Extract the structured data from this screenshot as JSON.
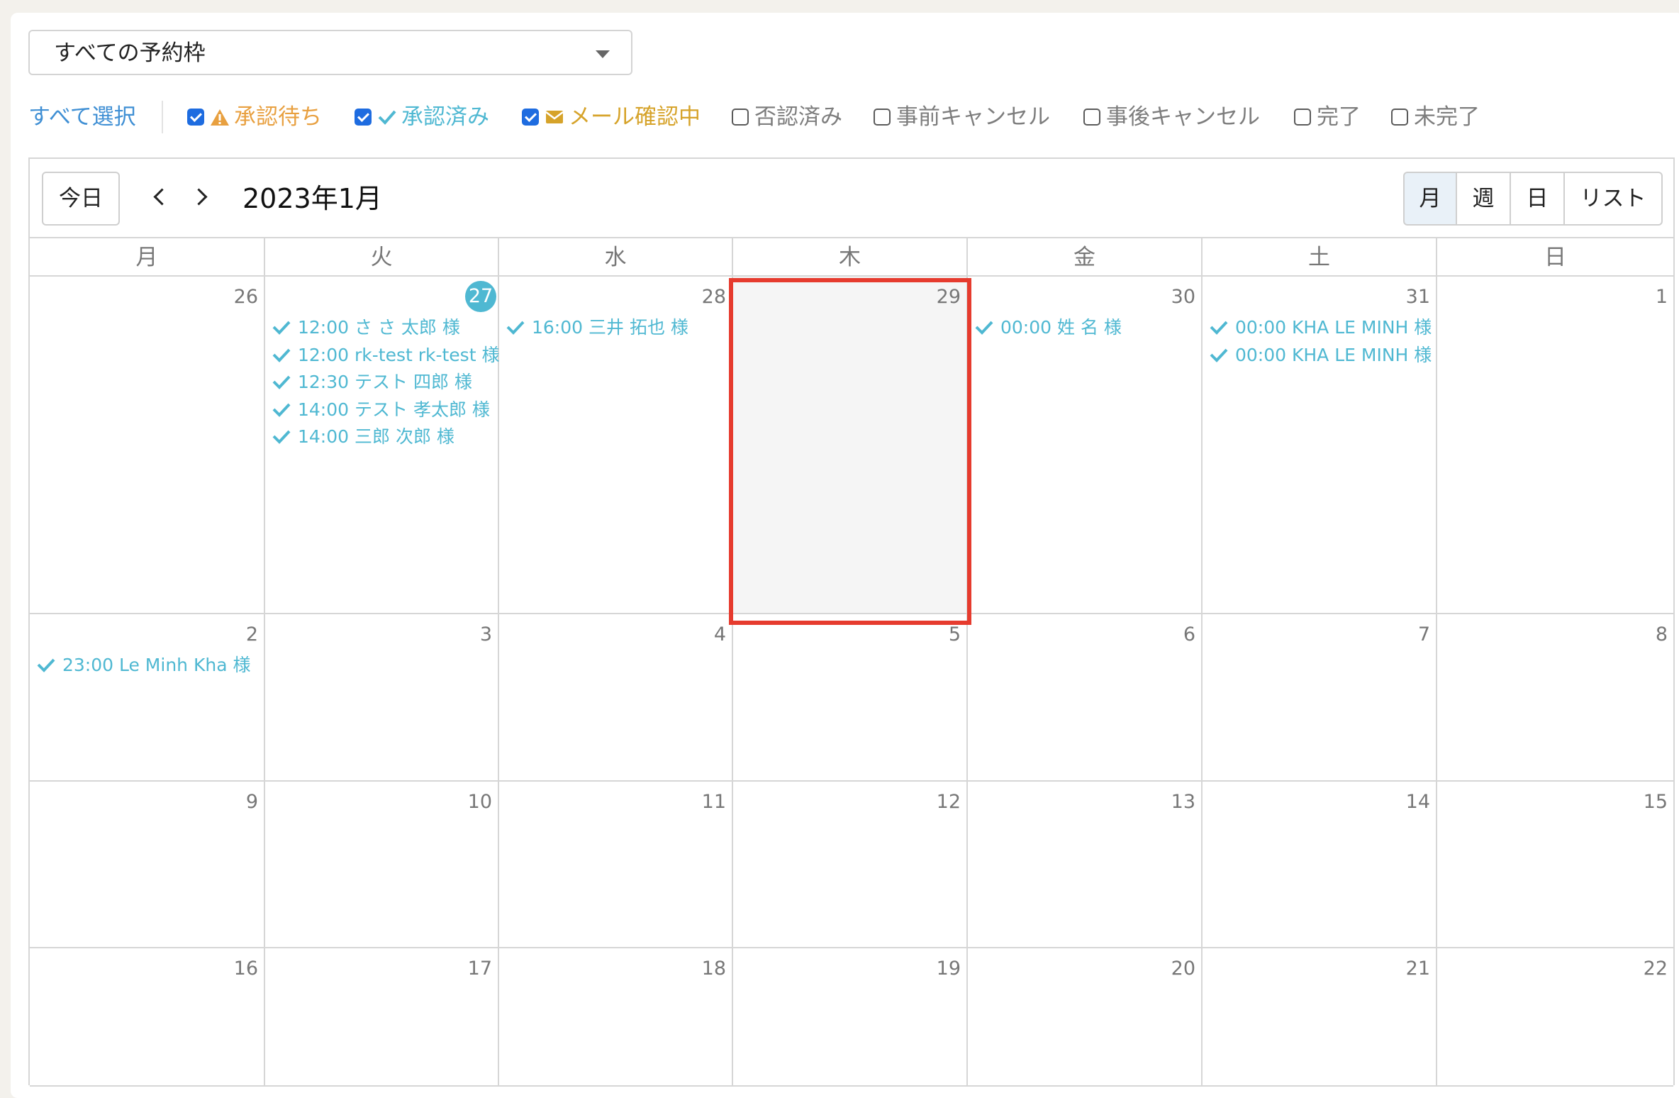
{
  "slot_select": {
    "label": "すべての予約枠"
  },
  "filters": {
    "select_all": "すべて選択",
    "items": [
      {
        "label": "承認待ち",
        "checked": true,
        "icon": "warning-icon",
        "color": "#e8a040"
      },
      {
        "label": "承認済み",
        "checked": true,
        "icon": "check-icon",
        "color": "#4fb8d2"
      },
      {
        "label": "メール確認中",
        "checked": true,
        "icon": "mail-icon",
        "color": "#d6a32a"
      },
      {
        "label": "否認済み",
        "checked": false
      },
      {
        "label": "事前キャンセル",
        "checked": false
      },
      {
        "label": "事後キャンセル",
        "checked": false
      },
      {
        "label": "完了",
        "checked": false
      },
      {
        "label": "未完了",
        "checked": false
      }
    ]
  },
  "toolbar": {
    "today": "今日",
    "title": "2023年1月",
    "views": [
      "月",
      "週",
      "日",
      "リスト"
    ],
    "active_view": "月"
  },
  "weekdays": [
    "月",
    "火",
    "水",
    "木",
    "金",
    "土",
    "日"
  ],
  "weeks": [
    [
      {
        "day": "26",
        "events": []
      },
      {
        "day": "27",
        "today": true,
        "events": [
          "12:00 さ さ 太郎 様",
          "12:00 rk-test rk-test 様",
          "12:30 テスト 四郎 様",
          "14:00 テスト 孝太郎 様",
          "14:00 三郎 次郎 様"
        ]
      },
      {
        "day": "28",
        "events": [
          "16:00 三井 拓也 様"
        ]
      },
      {
        "day": "29",
        "highlighted": true,
        "events": []
      },
      {
        "day": "30",
        "events": [
          "00:00 姓 名 様"
        ]
      },
      {
        "day": "31",
        "events": [
          "00:00 KHA LE MINH 様",
          "00:00 KHA LE MINH 様"
        ]
      },
      {
        "day": "1",
        "events": []
      }
    ],
    [
      {
        "day": "2",
        "events": [
          "23:00 Le Minh Kha 様"
        ]
      },
      {
        "day": "3",
        "events": []
      },
      {
        "day": "4",
        "events": []
      },
      {
        "day": "5",
        "events": []
      },
      {
        "day": "6",
        "events": []
      },
      {
        "day": "7",
        "events": []
      },
      {
        "day": "8",
        "events": []
      }
    ],
    [
      {
        "day": "9",
        "events": []
      },
      {
        "day": "10",
        "events": []
      },
      {
        "day": "11",
        "events": []
      },
      {
        "day": "12",
        "events": []
      },
      {
        "day": "13",
        "events": []
      },
      {
        "day": "14",
        "events": []
      },
      {
        "day": "15",
        "events": []
      }
    ],
    [
      {
        "day": "16",
        "events": []
      },
      {
        "day": "17",
        "events": []
      },
      {
        "day": "18",
        "events": []
      },
      {
        "day": "19",
        "events": []
      },
      {
        "day": "20",
        "events": []
      },
      {
        "day": "21",
        "events": []
      },
      {
        "day": "22",
        "events": []
      }
    ]
  ],
  "colors": {
    "event": "#4fb8d2",
    "highlight_border": "#e63b2e",
    "today_badge": "#4fb8d2"
  }
}
